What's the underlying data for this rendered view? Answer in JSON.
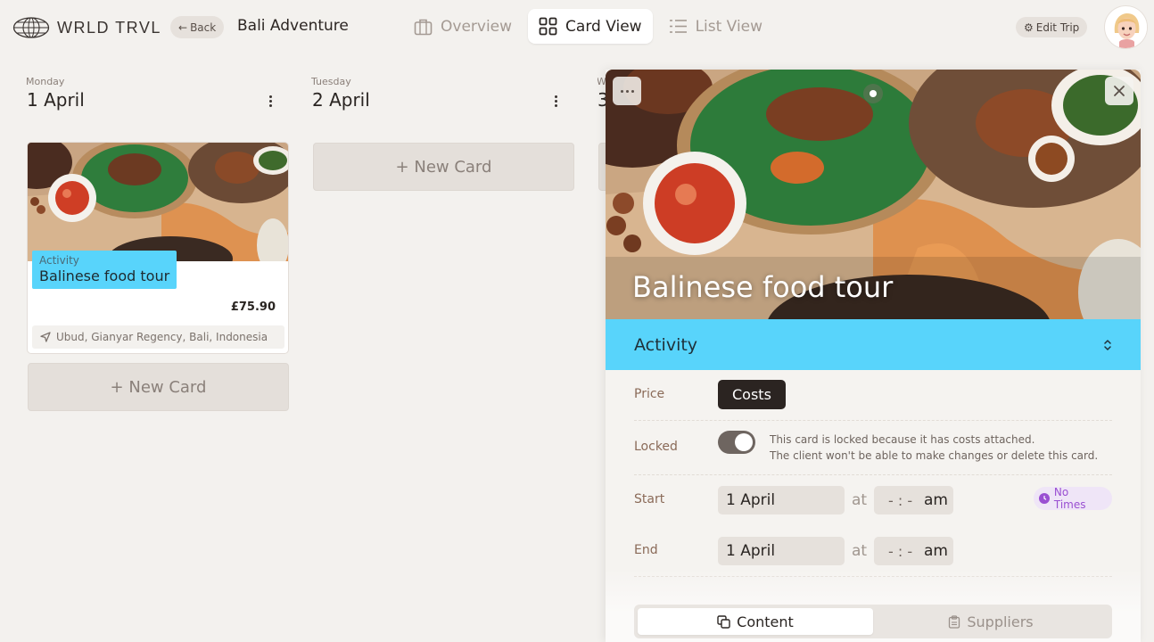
{
  "app": {
    "brand": "WRLD TRVL",
    "back_label": "Back",
    "trip_title": "Bali Adventure",
    "edit_trip_label": "Edit Trip"
  },
  "view_tabs": [
    {
      "label": "Overview",
      "icon": "briefcase-icon",
      "active": false
    },
    {
      "label": "Card View",
      "icon": "grid-icon",
      "active": true
    },
    {
      "label": "List View",
      "icon": "list-icon",
      "active": false
    }
  ],
  "days": [
    {
      "weekday": "Monday",
      "date": "1 April"
    },
    {
      "weekday": "Tuesday",
      "date": "2 April"
    },
    {
      "weekday": "W",
      "date": "3"
    }
  ],
  "new_card_label": "+ New Card",
  "card": {
    "type": "Activity",
    "title": "Balinese food tour",
    "price": "£75.90",
    "location": "Ubud, Gianyar Regency, Bali, Indonesia"
  },
  "panel": {
    "title": "Balinese food tour",
    "type": "Activity",
    "price_label": "Price",
    "costs_label": "Costs",
    "locked_label": "Locked",
    "locked_on": true,
    "lock_note_1": "This card is locked because it has costs attached.",
    "lock_note_2": "The client won't be able to make changes or delete this card.",
    "start_label": "Start",
    "start_date": "1 April",
    "start_time": "- : -",
    "start_ampm": "am",
    "end_label": "End",
    "end_date": "1 April",
    "end_time": "- : -",
    "end_ampm": "am",
    "at_label": "at",
    "no_times_label": "No Times",
    "tabs": [
      {
        "label": "Content",
        "icon": "content-icon",
        "active": true
      },
      {
        "label": "Suppliers",
        "icon": "clipboard-icon",
        "active": false
      }
    ]
  },
  "colors": {
    "accent": "#58d4fb",
    "background": "#f3f1ee",
    "badge_purple": "#9a4fd2"
  }
}
